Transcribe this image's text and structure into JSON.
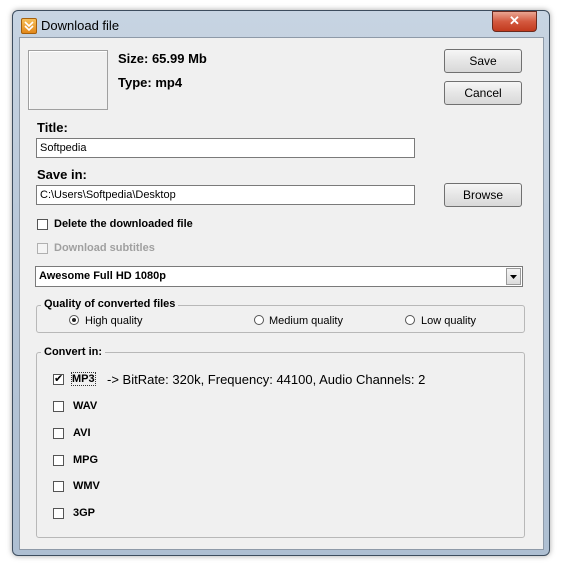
{
  "window": {
    "title": "Download file",
    "close_glyph": "✕"
  },
  "info": {
    "size": "Size: 65.99 Mb",
    "type": "Type: mp4"
  },
  "buttons": {
    "save": "Save",
    "cancel": "Cancel",
    "browse": "Browse"
  },
  "title_field": {
    "label": "Title:",
    "value": "Softpedia"
  },
  "save_in": {
    "label": "Save in:",
    "value": "C:\\Users\\Softpedia\\Desktop"
  },
  "options": {
    "delete_downloaded": {
      "label": "Delete the downloaded file",
      "checked": false
    },
    "download_subtitles": {
      "label": "Download subtitles",
      "checked": false,
      "enabled": false
    }
  },
  "preset": {
    "selected": "Awesome Full HD 1080p"
  },
  "quality": {
    "title": "Quality of converted files",
    "options": [
      {
        "label": "High quality",
        "selected": true
      },
      {
        "label": "Medium quality",
        "selected": false
      },
      {
        "label": "Low quality",
        "selected": false
      }
    ]
  },
  "convert": {
    "title": "Convert in:",
    "formats": [
      {
        "label": "MP3",
        "checked": true,
        "detail": "-> BitRate: 320k, Frequency: 44100, Audio Channels: 2"
      },
      {
        "label": "WAV",
        "checked": false
      },
      {
        "label": "AVI",
        "checked": false
      },
      {
        "label": "MPG",
        "checked": false
      },
      {
        "label": "WMV",
        "checked": false
      },
      {
        "label": "3GP",
        "checked": false
      }
    ]
  }
}
